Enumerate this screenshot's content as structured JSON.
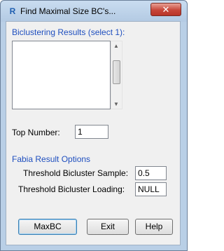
{
  "window": {
    "title": "Find Maximal Size BC's...",
    "app_icon": "R",
    "close_glyph": "✕"
  },
  "biclustering": {
    "label": "Biclustering Results (select 1):",
    "items": [],
    "scroll_up": "▲",
    "scroll_down": "▼"
  },
  "top_number": {
    "label": "Top Number:",
    "value": "1"
  },
  "fabia": {
    "section_label": "Fabia Result Options",
    "threshold_sample_label": "Threshold Bicluster Sample:",
    "threshold_sample_value": "0.5",
    "threshold_loading_label": "Threshold Bicluster Loading:",
    "threshold_loading_value": "NULL"
  },
  "buttons": {
    "maxbc": "MaxBC",
    "exit": "Exit",
    "help": "Help"
  },
  "colors": {
    "accent_label": "#1f4fbf",
    "window_frame": "#b9cfe6",
    "close_button": "#c7473a"
  }
}
